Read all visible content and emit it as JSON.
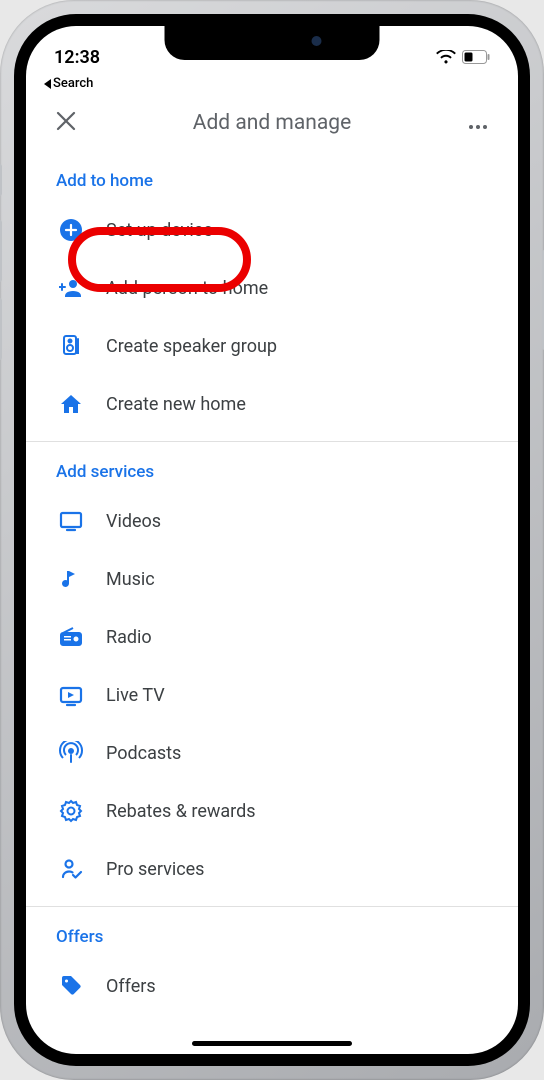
{
  "status": {
    "time": "12:38",
    "back_label": "Search"
  },
  "header": {
    "title": "Add and manage"
  },
  "sections": [
    {
      "title": "Add to home"
    },
    {
      "title": "Add services"
    },
    {
      "title": "Offers"
    }
  ],
  "home_items": [
    {
      "label": "Set up device"
    },
    {
      "label": "Add person to home"
    },
    {
      "label": "Create speaker group"
    },
    {
      "label": "Create new home"
    }
  ],
  "service_items": [
    {
      "label": "Videos"
    },
    {
      "label": "Music"
    },
    {
      "label": "Radio"
    },
    {
      "label": "Live TV"
    },
    {
      "label": "Podcasts"
    },
    {
      "label": "Rebates & rewards"
    },
    {
      "label": "Pro services"
    }
  ],
  "offer_items": [
    {
      "label": "Offers"
    }
  ],
  "highlight": {
    "target_label": "Set up device"
  }
}
